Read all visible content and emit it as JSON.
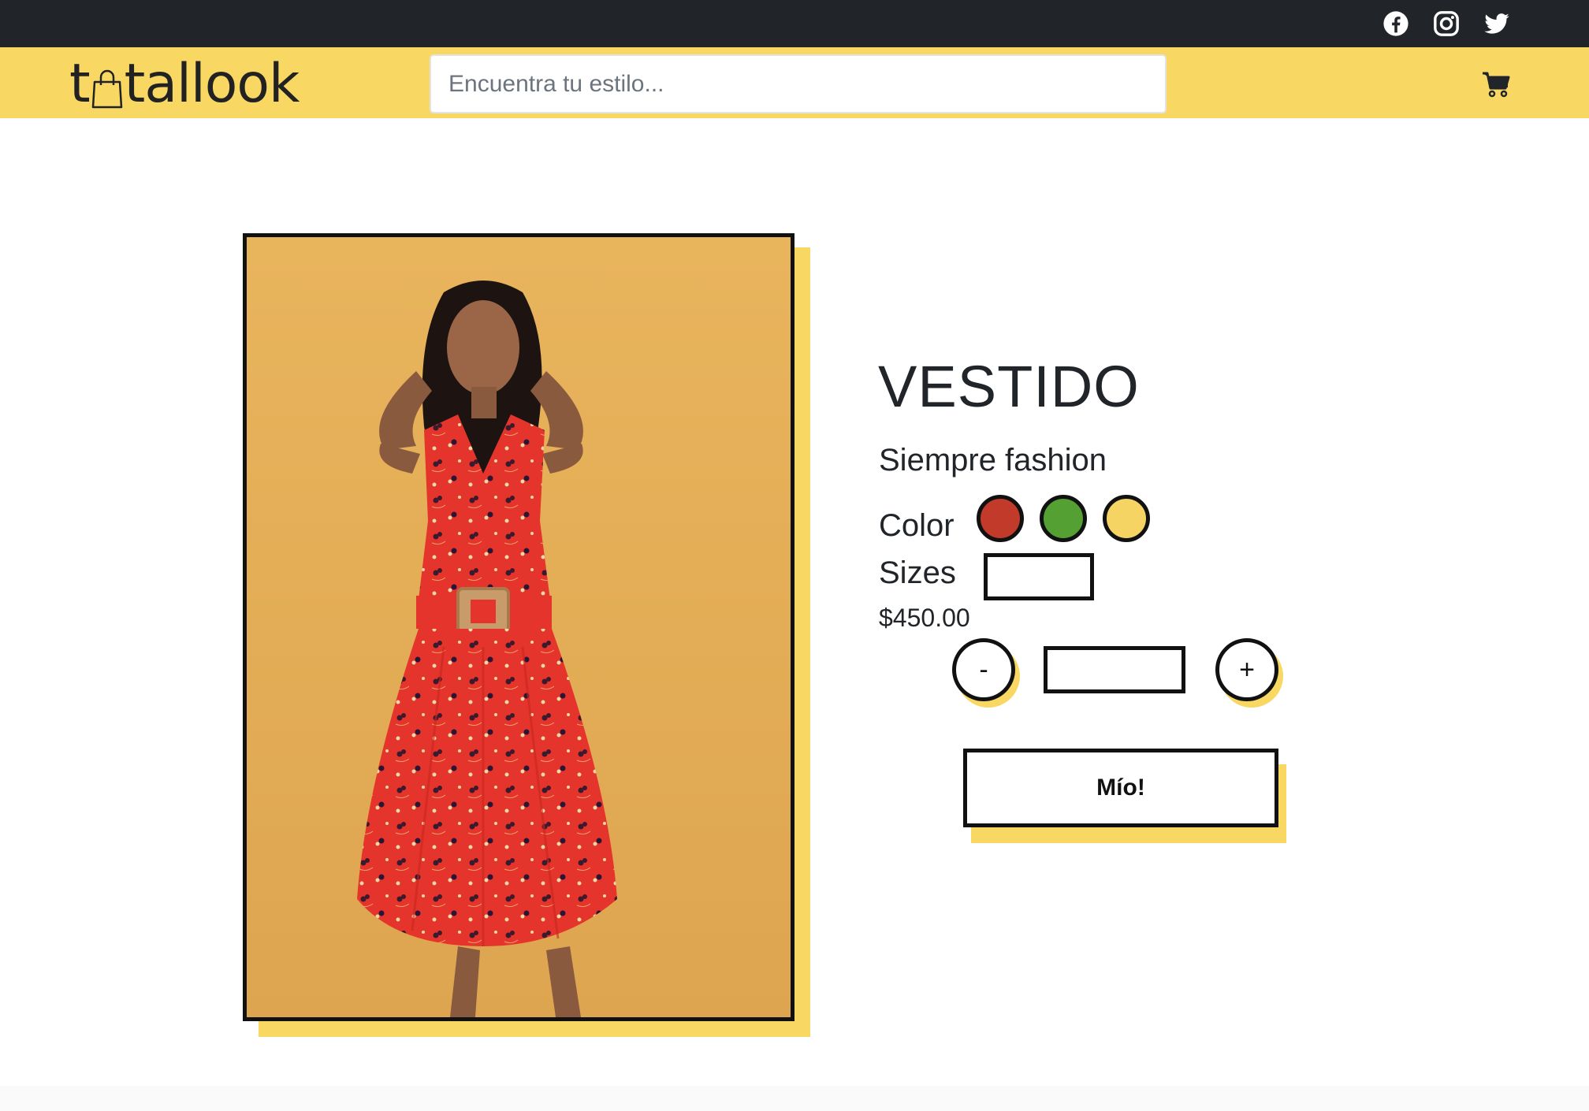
{
  "header": {
    "logo": {
      "prefix": "t",
      "suffix": "tallook"
    },
    "search": {
      "placeholder": "Encuentra tu estilo...",
      "value": ""
    },
    "social_icons": [
      "facebook-icon",
      "instagram-icon",
      "twitter-icon"
    ],
    "cart_icon": "cart-icon"
  },
  "product": {
    "title": "VESTIDO",
    "subtitle": "Siempre fashion",
    "color_label": "Color",
    "colors": [
      "#c23b2a",
      "#54a032",
      "#f5d463"
    ],
    "sizes_label": "Sizes",
    "size_value": "",
    "price": "$450.00",
    "quantity": {
      "minus_label": "-",
      "plus_label": "+",
      "value": ""
    },
    "buy_label": "Mío!"
  },
  "theme": {
    "accent": "#f8d862",
    "dark": "#212529",
    "image_bg": "#e6ad57",
    "dress": "#e8332a"
  }
}
